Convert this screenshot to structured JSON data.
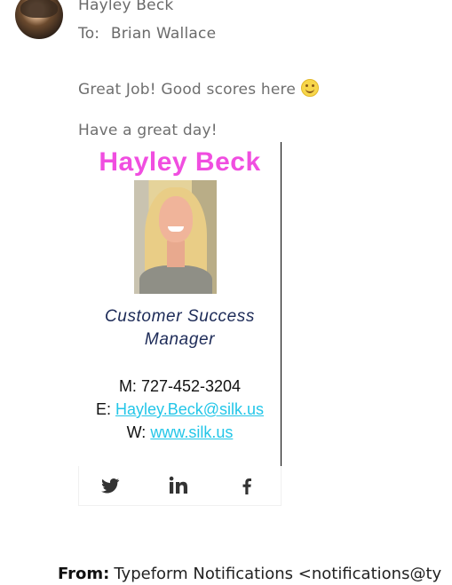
{
  "message": {
    "sender_name": "Hayley Beck",
    "to_label": "To:",
    "to_name": "Brian Wallace",
    "line1": "Great Job! Good scores here",
    "line2": "Have a great day!"
  },
  "signature": {
    "name": "Hayley Beck",
    "title": "Customer Success Manager",
    "phone_label": "M:",
    "phone": "727-452-3204",
    "email_label": "E:",
    "email": "Hayley.Beck@silk.us",
    "web_label": "W:",
    "web": "www.silk.us",
    "colors": {
      "name": "#f04ee0",
      "title": "#1c2a57",
      "link": "#23c6e8"
    }
  },
  "social_icons": [
    "twitter-icon",
    "linkedin-icon",
    "facebook-icon"
  ],
  "forward": {
    "from_label": "From:",
    "from_value": "Typeform Notifications <notifications@ty"
  }
}
